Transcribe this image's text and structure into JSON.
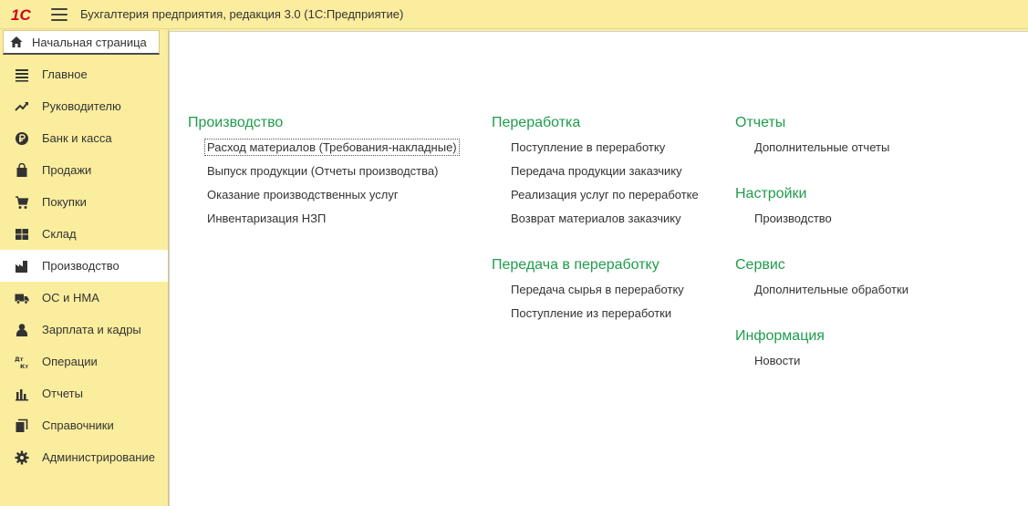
{
  "app": {
    "title": "Бухгалтерия предприятия, редакция 3.0  (1С:Предприятие)",
    "logo_text": "1С",
    "home_tab": "Начальная страница"
  },
  "colors": {
    "sidebar_bg": "#fbed9e",
    "section_heading": "#1f9c4c",
    "text": "#333333"
  },
  "sidebar": {
    "items": [
      {
        "label": "Главное",
        "icon": "list-icon"
      },
      {
        "label": "Руководителю",
        "icon": "trend-icon"
      },
      {
        "label": "Банк и касса",
        "icon": "ruble-icon"
      },
      {
        "label": "Продажи",
        "icon": "bag-icon"
      },
      {
        "label": "Покупки",
        "icon": "cart-icon"
      },
      {
        "label": "Склад",
        "icon": "warehouse-icon"
      },
      {
        "label": "Производство",
        "icon": "factory-icon",
        "active": true
      },
      {
        "label": "ОС и НМА",
        "icon": "truck-icon"
      },
      {
        "label": "Зарплата и кадры",
        "icon": "person-icon"
      },
      {
        "label": "Операции",
        "icon": "dt-kt-icon",
        "icon_text_top": "Дт",
        "icon_text_bottom": "Кт"
      },
      {
        "label": "Отчеты",
        "icon": "bar-chart-icon"
      },
      {
        "label": "Справочники",
        "icon": "books-icon"
      },
      {
        "label": "Администрирование",
        "icon": "gear-icon"
      }
    ]
  },
  "main": {
    "sections": [
      {
        "title": "Производство",
        "links": [
          "Расход материалов (Требования-накладные)",
          "Выпуск продукции (Отчеты производства)",
          "Оказание производственных услуг",
          "Инвентаризация НЗП"
        ]
      },
      {
        "title": "Переработка",
        "links": [
          "Поступление в переработку",
          "Передача продукции заказчику",
          "Реализация услуг по переработке",
          "Возврат материалов заказчику"
        ]
      },
      {
        "title": "Передача в переработку",
        "links": [
          "Передача сырья в переработку",
          "Поступление из переработки"
        ]
      },
      {
        "title": "Отчеты",
        "links": [
          "Дополнительные отчеты"
        ]
      },
      {
        "title": "Настройки",
        "links": [
          "Производство"
        ]
      },
      {
        "title": "Сервис",
        "links": [
          "Дополнительные обработки"
        ]
      },
      {
        "title": "Информация",
        "links": [
          "Новости"
        ]
      }
    ]
  }
}
